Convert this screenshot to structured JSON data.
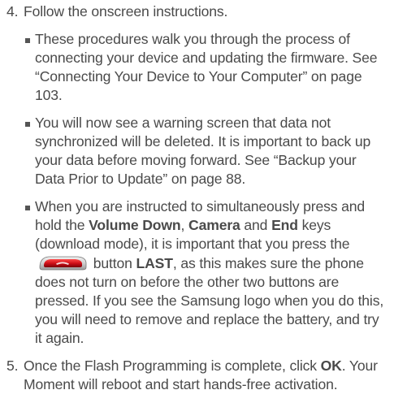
{
  "step4": {
    "number": "4.",
    "text": "Follow the onscreen instructions.",
    "bullets": {
      "b1": {
        "text": "These procedures walk you through the process of connecting your device and updating the firmware. See “Connecting Your Device to Your Computer” on page 103."
      },
      "b2": {
        "text": "You will now see a warning screen that data not synchronized will be deleted. It is important to back up your data before moving forward. See “Backup your Data Prior to Update” on page 88."
      },
      "b3": {
        "t1": "When you are instructed to simultaneously press and hold the ",
        "k1": "Volume Down",
        "t2": ", ",
        "k2": "Camera",
        "t3": " and ",
        "k3": "End",
        "t4": " keys (download mode), it is important that you press the",
        "icon": "end-call-key-icon",
        "t5": " button ",
        "k4": "LAST",
        "t6": ", as this makes sure the phone does not turn on before the other two buttons are pressed. If you see the Samsung logo when you do this, you will need to remove and replace the battery, and try it again."
      }
    }
  },
  "step5": {
    "number": "5.",
    "t1": "Once the Flash Programming is complete, click ",
    "k1": "OK",
    "t2": ". Your Moment will reboot and start hands-free activation."
  },
  "colors": {
    "text": "#4a4a4a",
    "end_key_red": "#c8101a",
    "end_key_body": "#d9d9d9"
  }
}
